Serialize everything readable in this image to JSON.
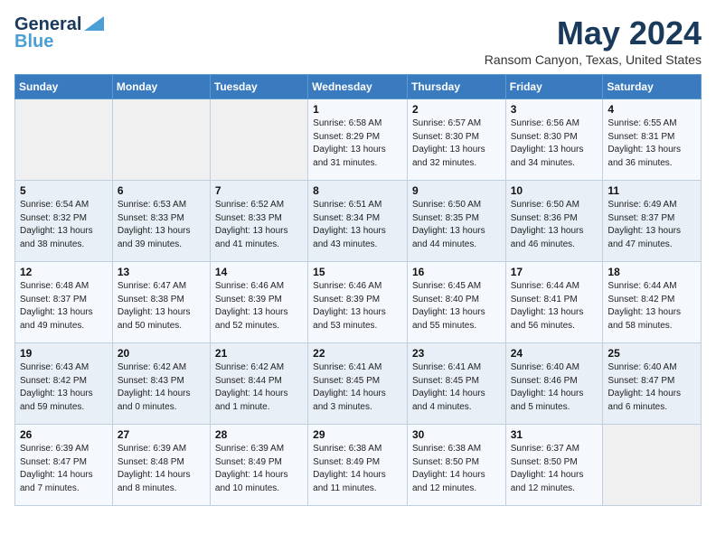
{
  "header": {
    "logo_line1": "General",
    "logo_line2": "Blue",
    "month_year": "May 2024",
    "location": "Ransom Canyon, Texas, United States"
  },
  "days_of_week": [
    "Sunday",
    "Monday",
    "Tuesday",
    "Wednesday",
    "Thursday",
    "Friday",
    "Saturday"
  ],
  "weeks": [
    [
      {
        "day": "",
        "info": ""
      },
      {
        "day": "",
        "info": ""
      },
      {
        "day": "",
        "info": ""
      },
      {
        "day": "1",
        "info": "Sunrise: 6:58 AM\nSunset: 8:29 PM\nDaylight: 13 hours\nand 31 minutes."
      },
      {
        "day": "2",
        "info": "Sunrise: 6:57 AM\nSunset: 8:30 PM\nDaylight: 13 hours\nand 32 minutes."
      },
      {
        "day": "3",
        "info": "Sunrise: 6:56 AM\nSunset: 8:30 PM\nDaylight: 13 hours\nand 34 minutes."
      },
      {
        "day": "4",
        "info": "Sunrise: 6:55 AM\nSunset: 8:31 PM\nDaylight: 13 hours\nand 36 minutes."
      }
    ],
    [
      {
        "day": "5",
        "info": "Sunrise: 6:54 AM\nSunset: 8:32 PM\nDaylight: 13 hours\nand 38 minutes."
      },
      {
        "day": "6",
        "info": "Sunrise: 6:53 AM\nSunset: 8:33 PM\nDaylight: 13 hours\nand 39 minutes."
      },
      {
        "day": "7",
        "info": "Sunrise: 6:52 AM\nSunset: 8:33 PM\nDaylight: 13 hours\nand 41 minutes."
      },
      {
        "day": "8",
        "info": "Sunrise: 6:51 AM\nSunset: 8:34 PM\nDaylight: 13 hours\nand 43 minutes."
      },
      {
        "day": "9",
        "info": "Sunrise: 6:50 AM\nSunset: 8:35 PM\nDaylight: 13 hours\nand 44 minutes."
      },
      {
        "day": "10",
        "info": "Sunrise: 6:50 AM\nSunset: 8:36 PM\nDaylight: 13 hours\nand 46 minutes."
      },
      {
        "day": "11",
        "info": "Sunrise: 6:49 AM\nSunset: 8:37 PM\nDaylight: 13 hours\nand 47 minutes."
      }
    ],
    [
      {
        "day": "12",
        "info": "Sunrise: 6:48 AM\nSunset: 8:37 PM\nDaylight: 13 hours\nand 49 minutes."
      },
      {
        "day": "13",
        "info": "Sunrise: 6:47 AM\nSunset: 8:38 PM\nDaylight: 13 hours\nand 50 minutes."
      },
      {
        "day": "14",
        "info": "Sunrise: 6:46 AM\nSunset: 8:39 PM\nDaylight: 13 hours\nand 52 minutes."
      },
      {
        "day": "15",
        "info": "Sunrise: 6:46 AM\nSunset: 8:39 PM\nDaylight: 13 hours\nand 53 minutes."
      },
      {
        "day": "16",
        "info": "Sunrise: 6:45 AM\nSunset: 8:40 PM\nDaylight: 13 hours\nand 55 minutes."
      },
      {
        "day": "17",
        "info": "Sunrise: 6:44 AM\nSunset: 8:41 PM\nDaylight: 13 hours\nand 56 minutes."
      },
      {
        "day": "18",
        "info": "Sunrise: 6:44 AM\nSunset: 8:42 PM\nDaylight: 13 hours\nand 58 minutes."
      }
    ],
    [
      {
        "day": "19",
        "info": "Sunrise: 6:43 AM\nSunset: 8:42 PM\nDaylight: 13 hours\nand 59 minutes."
      },
      {
        "day": "20",
        "info": "Sunrise: 6:42 AM\nSunset: 8:43 PM\nDaylight: 14 hours\nand 0 minutes."
      },
      {
        "day": "21",
        "info": "Sunrise: 6:42 AM\nSunset: 8:44 PM\nDaylight: 14 hours\nand 1 minute."
      },
      {
        "day": "22",
        "info": "Sunrise: 6:41 AM\nSunset: 8:45 PM\nDaylight: 14 hours\nand 3 minutes."
      },
      {
        "day": "23",
        "info": "Sunrise: 6:41 AM\nSunset: 8:45 PM\nDaylight: 14 hours\nand 4 minutes."
      },
      {
        "day": "24",
        "info": "Sunrise: 6:40 AM\nSunset: 8:46 PM\nDaylight: 14 hours\nand 5 minutes."
      },
      {
        "day": "25",
        "info": "Sunrise: 6:40 AM\nSunset: 8:47 PM\nDaylight: 14 hours\nand 6 minutes."
      }
    ],
    [
      {
        "day": "26",
        "info": "Sunrise: 6:39 AM\nSunset: 8:47 PM\nDaylight: 14 hours\nand 7 minutes."
      },
      {
        "day": "27",
        "info": "Sunrise: 6:39 AM\nSunset: 8:48 PM\nDaylight: 14 hours\nand 8 minutes."
      },
      {
        "day": "28",
        "info": "Sunrise: 6:39 AM\nSunset: 8:49 PM\nDaylight: 14 hours\nand 10 minutes."
      },
      {
        "day": "29",
        "info": "Sunrise: 6:38 AM\nSunset: 8:49 PM\nDaylight: 14 hours\nand 11 minutes."
      },
      {
        "day": "30",
        "info": "Sunrise: 6:38 AM\nSunset: 8:50 PM\nDaylight: 14 hours\nand 12 minutes."
      },
      {
        "day": "31",
        "info": "Sunrise: 6:37 AM\nSunset: 8:50 PM\nDaylight: 14 hours\nand 12 minutes."
      },
      {
        "day": "",
        "info": ""
      }
    ]
  ]
}
